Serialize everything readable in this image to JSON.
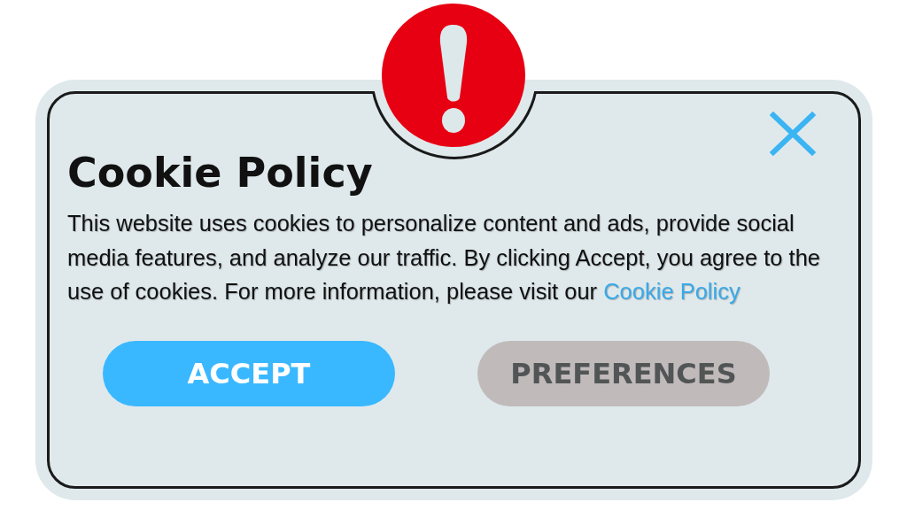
{
  "dialog": {
    "title": "Cookie Policy",
    "message": "This website uses cookies to personalize content and ads, provide social media features, and analyze our traffic. By clicking Accept, you agree to the use of cookies. For more information, please visit our",
    "link": "Cookie Policy",
    "buttons": [
      {
        "label": "ACCEPT",
        "kind": "primary"
      },
      {
        "label": "PREFERENCES",
        "kind": "secondary"
      }
    ]
  }
}
